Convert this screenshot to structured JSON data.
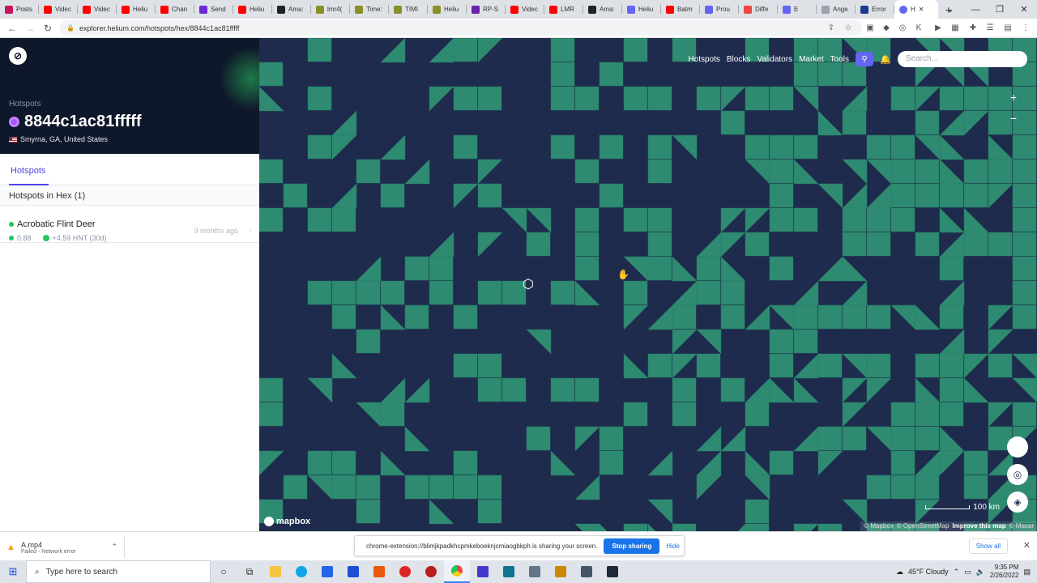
{
  "browser": {
    "tabs": [
      {
        "label": "Posts",
        "color": "#c2185b"
      },
      {
        "label": "Videc",
        "color": "#ff0000"
      },
      {
        "label": "Videc",
        "color": "#ff0000"
      },
      {
        "label": "Heliu",
        "color": "#ff0000"
      },
      {
        "label": "Chan",
        "color": "#ff0000"
      },
      {
        "label": "Send",
        "color": "#6d28d9"
      },
      {
        "label": "Heliu",
        "color": "#ff0000"
      },
      {
        "label": "Ama:",
        "color": "#222222"
      },
      {
        "label": "lmr4(",
        "color": "#8a8f2a"
      },
      {
        "label": "Time:",
        "color": "#8a8f2a"
      },
      {
        "label": "TIMI",
        "color": "#8a8f2a"
      },
      {
        "label": "Heliu",
        "color": "#8a8f2a"
      },
      {
        "label": "RP-S",
        "color": "#6b21a8"
      },
      {
        "label": "Videc",
        "color": "#ff0000"
      },
      {
        "label": "LMR",
        "color": "#ff0000"
      },
      {
        "label": "Ama:",
        "color": "#222222"
      },
      {
        "label": "Heliu",
        "color": "#6366f1"
      },
      {
        "label": "Batm",
        "color": "#ff0000"
      },
      {
        "label": "Prou",
        "color": "#6366f1"
      },
      {
        "label": "Diffe",
        "color": "#ef4444"
      },
      {
        "label": "E",
        "color": "#6366f1"
      },
      {
        "label": "Ange",
        "color": "#9ca3af"
      },
      {
        "label": "Error",
        "color": "#1e3a8a"
      }
    ],
    "active_tab": {
      "label": "H",
      "color": "#6366f1"
    },
    "new_tab_label": "+",
    "url": "explorer.helium.com/hotspots/hex/8844c1ac81fffff"
  },
  "sidebar": {
    "breadcrumb": "Hotspots",
    "hex_id": "8844c1ac81fffff",
    "location": "Smyrna, GA, United States",
    "tab_label": "Hotspots",
    "list_header": "Hotspots in Hex (1)",
    "hotspot": {
      "name": "Acrobatic Flint Deer",
      "scale": "0.88",
      "earnings": "+4.59 HNT (30d)",
      "age": "9 months ago"
    }
  },
  "map": {
    "nav": [
      "Hotspots",
      "Blocks",
      "Validators",
      "Market",
      "Tools"
    ],
    "search_placeholder": "Search...",
    "zoom_in": "+",
    "zoom_out": "−",
    "brand": "mapbox",
    "scale_label": "100 km",
    "attribution": [
      "© Mapbox",
      "© OpenStreetMap",
      "Improve this map",
      "© Maxar"
    ],
    "colors": {
      "background": "#1e2b4d",
      "coverage": "#2e8b72"
    }
  },
  "download_bar": {
    "file_name": "A.mp4",
    "status": "Failed - Network error",
    "share_text": "chrome-extension://blimjkpadkhcpmkeboeknjcmiaogbkph is sharing your screen.",
    "stop_label": "Stop sharing",
    "hide_label": "Hide",
    "show_all_label": "Show all"
  },
  "taskbar": {
    "search_placeholder": "Type here to search",
    "weather": "45°F  Cloudy",
    "time": "9:35 PM",
    "date": "2/26/2022"
  }
}
